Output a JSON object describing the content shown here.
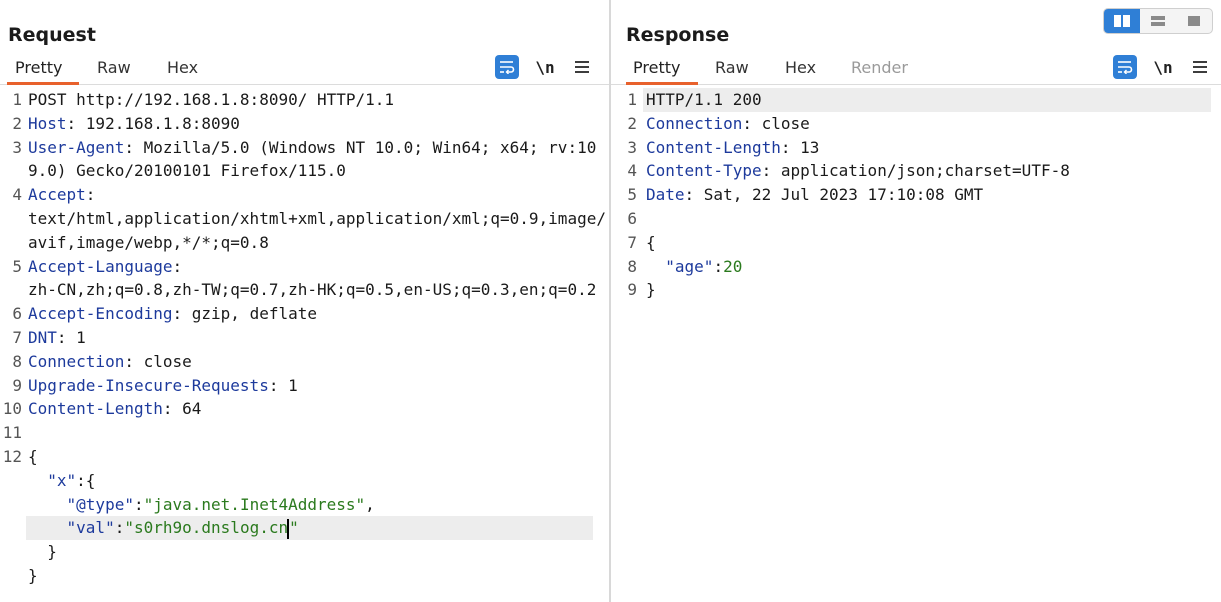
{
  "request": {
    "title": "Request",
    "tabs": [
      "Pretty",
      "Raw",
      "Hex"
    ],
    "active_tab": "Pretty",
    "tools": {
      "newline_label": "\\n"
    }
  },
  "response": {
    "title": "Response",
    "tabs": [
      "Pretty",
      "Raw",
      "Hex",
      "Render"
    ],
    "active_tab": "Pretty",
    "tools": {
      "newline_label": "\\n"
    }
  },
  "view_toggle": {
    "options": [
      "side-by-side",
      "stacked-horizontal",
      "single"
    ],
    "active": "side-by-side"
  },
  "colors": {
    "accent": "#2f7fd6",
    "tab_underline": "#e8612c",
    "header_key": "#1d3a9c",
    "json_string": "#2b7a1e"
  }
}
